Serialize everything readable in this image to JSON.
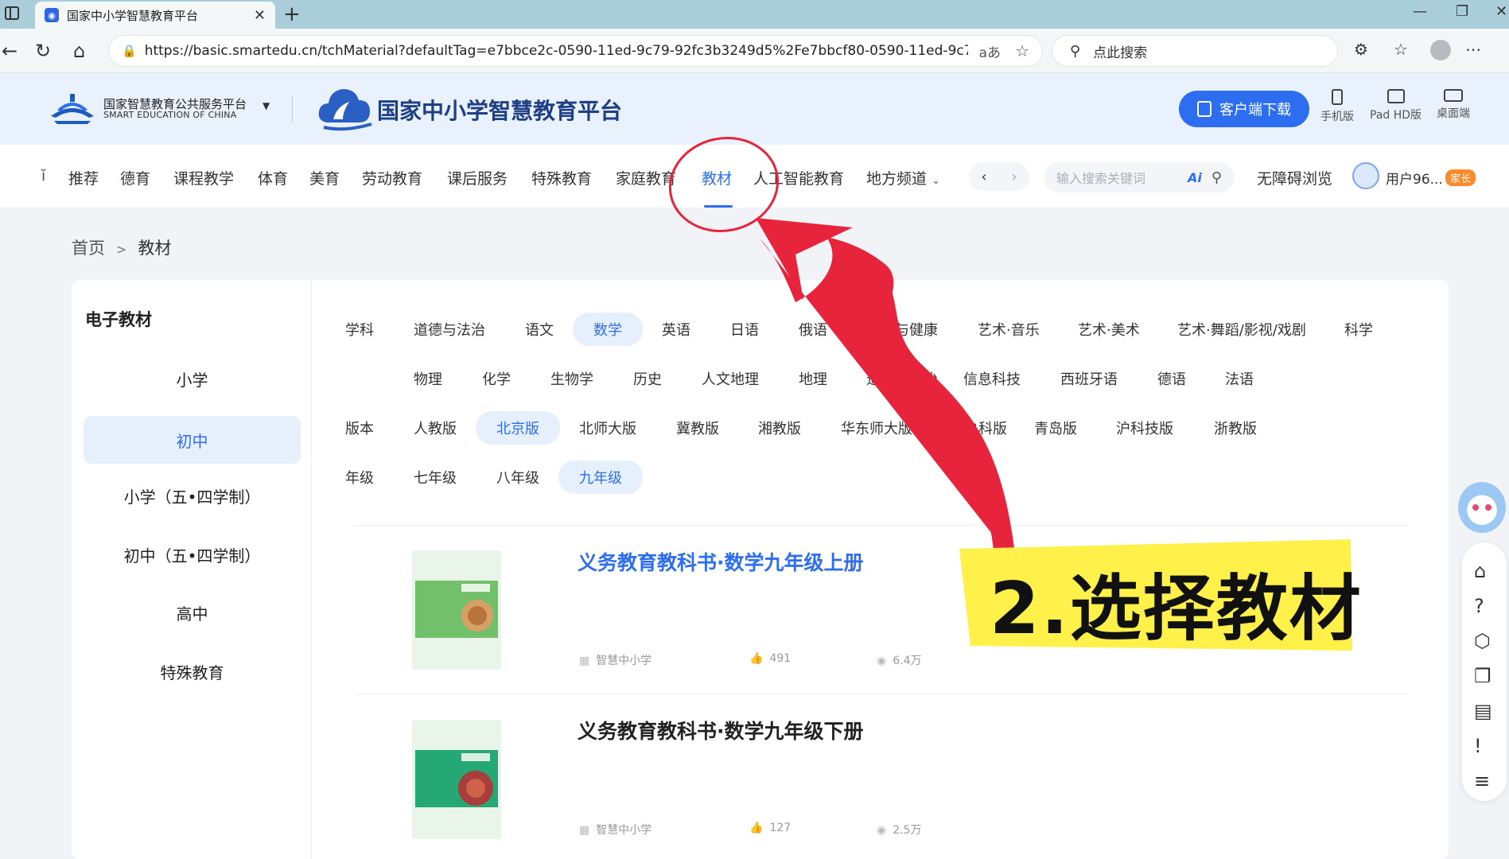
{
  "browser": {
    "tab_title": "国家中小学智慧教育平台",
    "tab_icon": "smartedu-favicon",
    "url": "https://basic.smartedu.cn/tchMaterial?defaultTag=e7bbce2c-0590-11ed-9c79-92fc3b3249d5%2Fe7bbcf80-0590-11ed-9c79-92fc3b3...",
    "read_aloud": "aあ",
    "search_placeholder": "点此搜索"
  },
  "header": {
    "gov_name": "国家智慧教育公共服务平台",
    "gov_name_en": "SMART EDUCATION OF CHINA",
    "brand": "国家中小学智慧教育平台",
    "download_label": "客户端下载",
    "devices": [
      "手机版",
      "Pad HD版",
      "桌面端"
    ],
    "brand_color": "#2d6ef0"
  },
  "nav": {
    "items": [
      "推荐",
      "德育",
      "课程教学",
      "体育",
      "美育",
      "劳动教育",
      "课后服务",
      "特殊教育",
      "家庭教育",
      "教材",
      "人工智能教育",
      "地方频道"
    ],
    "active": "教材",
    "keyword_placeholder": "输入搜索关键词",
    "ai_label": "Ai",
    "accessibility": "无障碍浏览",
    "user": "用户96...",
    "user_badge": "家长"
  },
  "breadcrumb": {
    "home": "首页",
    "sep": ">",
    "current": "教材"
  },
  "left_panel": {
    "title": "电子教材",
    "levels": [
      "小学",
      "初中",
      "小学（五•四学制）",
      "初中（五•四学制）",
      "高中",
      "特殊教育"
    ],
    "selected": "初中"
  },
  "filters": {
    "subject_label": "学科",
    "subjects_row1": [
      "道德与法治",
      "语文",
      "数学",
      "英语",
      "日语",
      "俄语",
      "体育与健康",
      "艺术·音乐",
      "艺术·美术",
      "艺术·舞蹈/影视/戏剧",
      "科学"
    ],
    "subjects_row2": [
      "物理",
      "化学",
      "生物学",
      "历史",
      "人文地理",
      "地理",
      "道德与法治",
      "信息科技",
      "西班牙语",
      "德语",
      "法语"
    ],
    "subject_selected": "数学",
    "version_label": "版本",
    "versions": [
      "人教版",
      "北京版",
      "北师大版",
      "冀教版",
      "湘教版",
      "华东师大版",
      "鲁科版",
      "青岛版",
      "沪科技版",
      "浙教版"
    ],
    "version_selected": "北京版",
    "grade_label": "年级",
    "grades": [
      "七年级",
      "八年级",
      "九年级"
    ],
    "grade_selected": "九年级"
  },
  "books": [
    {
      "title": "义务教育教科书·数学九年级上册",
      "publisher": "智慧中小学",
      "likes": "491",
      "views": "6.4万",
      "highlighted": true
    },
    {
      "title": "义务教育教科书·数学九年级下册",
      "publisher": "智慧中小学",
      "likes": "127",
      "views": "2.5万",
      "highlighted": false
    }
  ],
  "annotation": {
    "callout_text": "2.选择教材",
    "highlight_color": "#fff04a",
    "stroke_color": "#e8243d"
  }
}
